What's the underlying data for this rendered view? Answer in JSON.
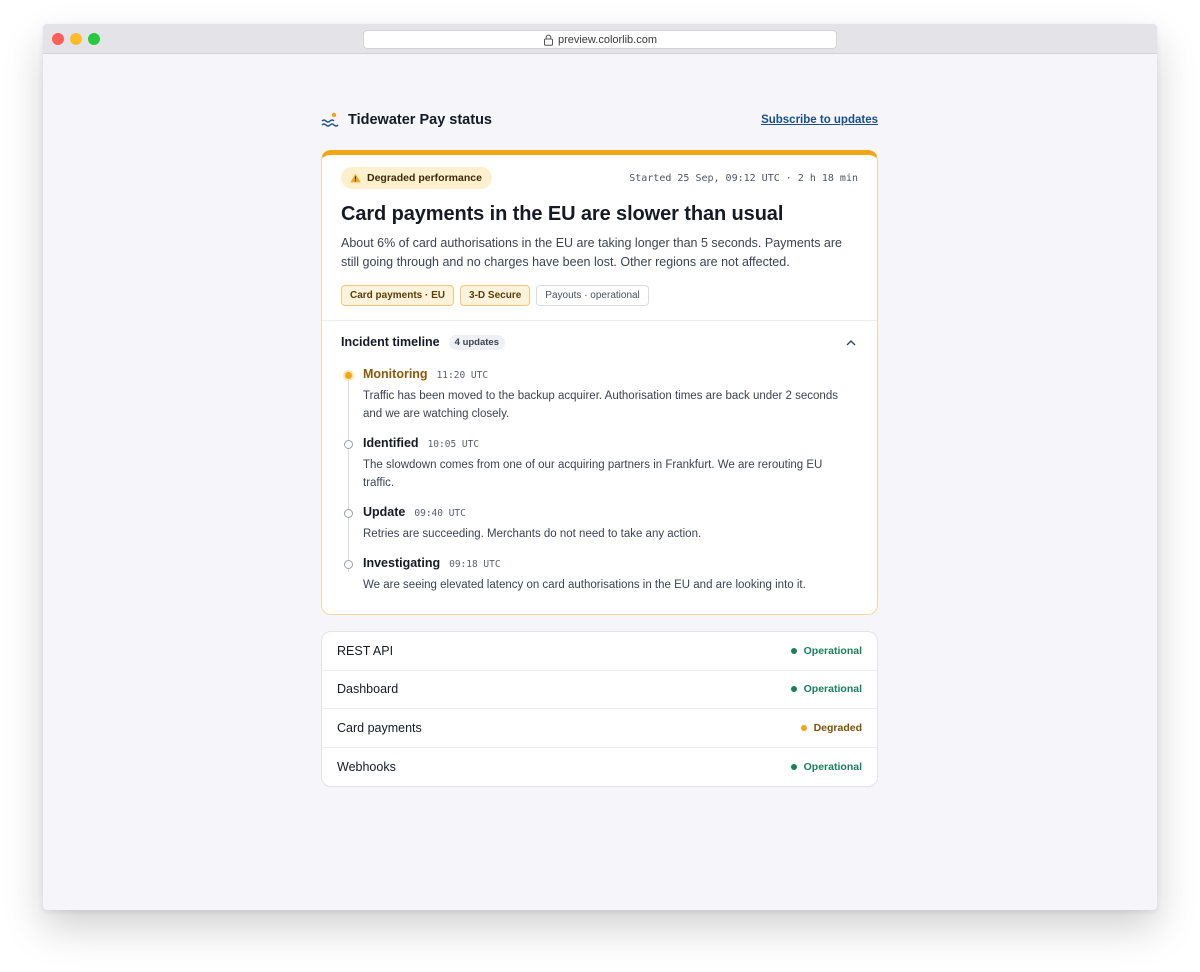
{
  "browser": {
    "url": "preview.colorlib.com"
  },
  "header": {
    "title": "Tidewater Pay status",
    "subscribe_label": "Subscribe to updates"
  },
  "incident": {
    "status_label": "Degraded performance",
    "started": "Started 25 Sep, 09:12 UTC · 2 h 18 min",
    "title": "Card payments in the EU are slower than usual",
    "description": "About 6% of card authorisations in the EU are taking longer than 5 seconds. Payments are still going through and no charges have been lost. Other regions are not affected.",
    "tags": [
      {
        "label": "Card payments · EU",
        "kind": "affected"
      },
      {
        "label": "3-D Secure",
        "kind": "affected"
      },
      {
        "label": "Payouts · operational",
        "kind": "ok"
      }
    ],
    "timeline_title": "Incident timeline",
    "timeline_count": "4 updates",
    "updates": [
      {
        "label": "Monitoring",
        "time": "11:20 UTC",
        "text": "Traffic has been moved to the backup acquirer. Authorisation times are back under 2 seconds and we are watching closely."
      },
      {
        "label": "Identified",
        "time": "10:05 UTC",
        "text": "The slowdown comes from one of our acquiring partners in Frankfurt. We are rerouting EU traffic."
      },
      {
        "label": "Update",
        "time": "09:40 UTC",
        "text": "Retries are succeeding. Merchants do not need to take any action."
      },
      {
        "label": "Investigating",
        "time": "09:18 UTC",
        "text": "We are seeing elevated latency on card authorisations in the EU and are looking into it."
      }
    ]
  },
  "components": [
    {
      "name": "REST API",
      "status": "Operational"
    },
    {
      "name": "Dashboard",
      "status": "Operational"
    },
    {
      "name": "Card payments",
      "status": "Degraded"
    },
    {
      "name": "Webhooks",
      "status": "Operational"
    }
  ],
  "colors": {
    "accent": "#f2a516",
    "operational": "#1a7f5a",
    "degraded": "#f2a516",
    "degraded_text": "#7a5206",
    "link": "#1a4f8c"
  }
}
